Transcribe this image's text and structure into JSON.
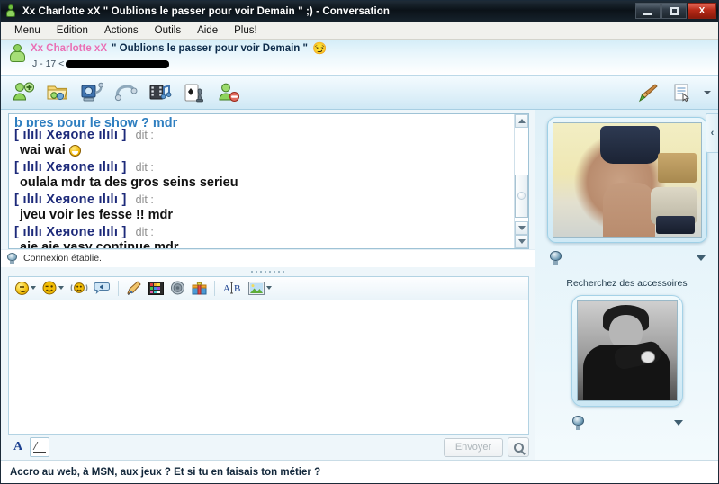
{
  "window": {
    "title": "Xx Charlotte xX \" Oublions le passer pour voir Demain \" ;) - Conversation",
    "app_icon": "contact-icon",
    "buttons": {
      "minimize": "minimize-icon",
      "restore": "restore-icon",
      "close": "X"
    }
  },
  "menubar": {
    "items": [
      {
        "label": "Menu"
      },
      {
        "label": "Edition"
      },
      {
        "label": "Actions"
      },
      {
        "label": "Outils"
      },
      {
        "label": "Aide"
      },
      {
        "label": "Plus!"
      }
    ]
  },
  "contact": {
    "name": "Xx Charlotte xX",
    "personal_message": "\" Oublions le passer pour voir Demain \"",
    "psm_emoji": "😏",
    "sub_prefix": "J - 17  <",
    "email_redacted": true,
    "name_color": "#ea70b5"
  },
  "toolbar": {
    "buttons": [
      {
        "name": "invite-contact-icon",
        "title": "Inviter"
      },
      {
        "name": "send-files-icon",
        "title": "Envoyer des fichiers"
      },
      {
        "name": "webcam-icon",
        "title": "Webcam"
      },
      {
        "name": "call-icon",
        "title": "Appeler"
      },
      {
        "name": "media-icon",
        "title": "Fichiers multimedia"
      },
      {
        "name": "games-icon",
        "title": "Jeux"
      },
      {
        "name": "block-contact-icon",
        "title": "Bloquer"
      }
    ],
    "right_buttons": [
      {
        "name": "paintbrush-icon",
        "title": "Personnaliser"
      },
      {
        "name": "notes-icon",
        "title": "Notes"
      }
    ]
  },
  "chat": {
    "partial_top_line": "b pres pour le show ? mdr",
    "sender_label": "[ ılılı Xeяone ılılı ]",
    "said_label": "dit :",
    "messages": [
      {
        "sender": "[ ılılı Xeяone ılılı ]",
        "said": "dit :",
        "text": "wai wai",
        "emoticon": "lol-emoticon"
      },
      {
        "sender": "[ ılılı Xeяone ılılı ]",
        "said": "dit :",
        "text": "oulala mdr ta des gros seins serieu",
        "emoticon": ""
      },
      {
        "sender": "[ ılılı Xeяone ılılı ]",
        "said": "dit :",
        "text": "jveu voir les fesse !! mdr",
        "emoticon": ""
      },
      {
        "sender": "[ ılılı Xeяone ılılı ]",
        "said": "dit :",
        "text": "aie aie vasy continue mdr",
        "emoticon": ""
      }
    ],
    "status": "Connexion établie.",
    "status_icon": "webcam-icon",
    "sender_color": "#1d2a7a",
    "partial_color": "#2f7fc0"
  },
  "compose": {
    "toolbar_buttons": [
      {
        "name": "emoticon-picker-icon",
        "has_caret": true
      },
      {
        "name": "wink-picker-icon",
        "has_caret": true
      },
      {
        "name": "nudge-icon",
        "has_caret": false
      },
      {
        "name": "voice-clip-icon",
        "has_caret": false
      },
      {
        "name": "handwriting-icon",
        "has_caret": false
      },
      {
        "name": "color-palette-icon",
        "has_caret": false
      },
      {
        "name": "sound-icon",
        "has_caret": false
      },
      {
        "name": "gift-icon",
        "has_caret": false
      },
      {
        "name": "font-format-icon",
        "has_caret": false
      },
      {
        "name": "background-image-icon",
        "has_caret": true
      }
    ],
    "input_value": "",
    "input_placeholder": "",
    "font_button": "A",
    "ink_button": "ink-pen-icon",
    "send_label": "Envoyer",
    "send_enabled": false,
    "magnifier": "magnifier-icon"
  },
  "ad": {
    "text": "Accro au web, à MSN, aux jeux ? Et si tu en faisais ton métier ?"
  },
  "right_panel": {
    "collapse_label": "‹",
    "video_caption": "",
    "video_cam_icon": "webcam-icon",
    "video_caret": "chevron-down-icon",
    "accessories_label": "Recherchez des accessoires",
    "selfview_cam_icon": "webcam-icon",
    "selfview_caret": "chevron-down-icon"
  }
}
